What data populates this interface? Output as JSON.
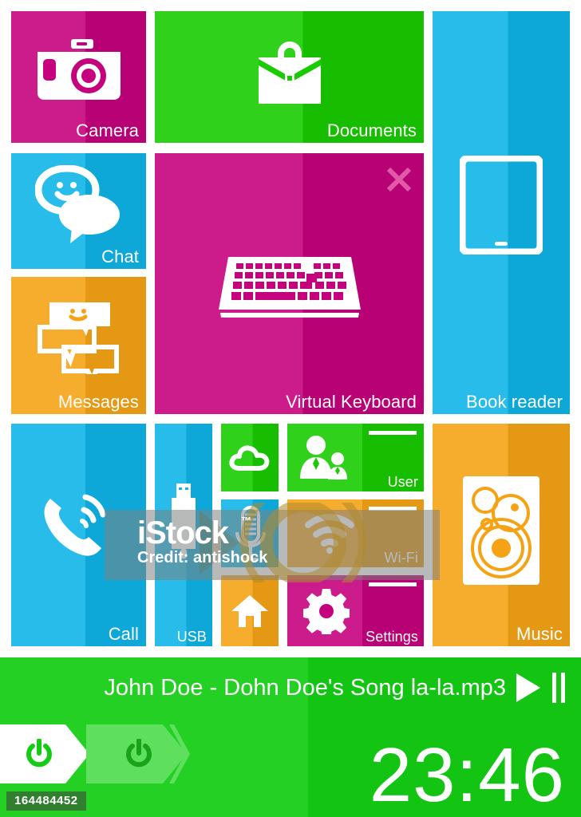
{
  "tiles": [
    {
      "id": "camera",
      "label": "Camera",
      "icon": "camera-icon",
      "color": "#c6017d"
    },
    {
      "id": "documents",
      "label": "Documents",
      "icon": "briefcase-icon",
      "color": "#19cc00"
    },
    {
      "id": "book-reader",
      "label": "Book reader",
      "icon": "tablet-icon",
      "color": "#0fb5e8"
    },
    {
      "id": "chat",
      "label": "Chat",
      "icon": "chat-bubble-icon",
      "color": "#0fb5e8"
    },
    {
      "id": "virtual-keyboard",
      "label": "Virtual Keyboard",
      "icon": "keyboard-icon",
      "color": "#c6017d"
    },
    {
      "id": "messages",
      "label": "Messages",
      "icon": "messages-icon",
      "color": "#f5a314"
    },
    {
      "id": "call",
      "label": "Call",
      "icon": "phone-icon",
      "color": "#0fb5e8"
    },
    {
      "id": "usb",
      "label": "USB",
      "icon": "usb-icon",
      "color": "#0fb5e8"
    },
    {
      "id": "cloud",
      "label": "",
      "icon": "cloud-icon",
      "color": "#19cc00"
    },
    {
      "id": "user",
      "label": "User",
      "icon": "user-icon",
      "color": "#19cc00"
    },
    {
      "id": "microphone",
      "label": "",
      "icon": "microphone-icon",
      "color": "#0fb5e8"
    },
    {
      "id": "wifi",
      "label": "Wi-Fi",
      "icon": "wifi-icon",
      "color": "#f5a314"
    },
    {
      "id": "home",
      "label": "",
      "icon": "home-icon",
      "color": "#f5a314"
    },
    {
      "id": "settings",
      "label": "Settings",
      "icon": "gear-icon",
      "color": "#c6017d"
    },
    {
      "id": "music",
      "label": "Music",
      "icon": "speaker-icon",
      "color": "#f5a314"
    }
  ],
  "keyboard_tile": {
    "close_icon": "close-icon"
  },
  "player": {
    "track_title": "John Doe - Dohn Doe's Song la-la.mp3",
    "play_icon": "play-icon",
    "pause_icon": "pause-icon",
    "clock": "23:46",
    "power_primary_icon": "power-icon",
    "power_secondary_icon": "power-icon",
    "background_color": "#14cc14"
  },
  "watermark": {
    "logo": "iStock",
    "trademark": "™",
    "credit": "Credit: antishock",
    "asset_id": "164484452"
  }
}
